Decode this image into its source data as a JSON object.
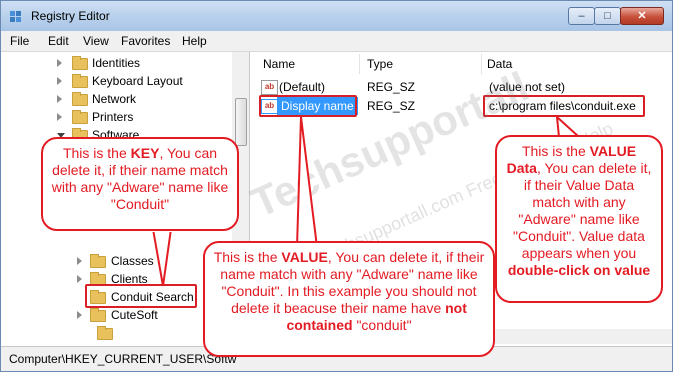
{
  "window": {
    "title": "Registry Editor",
    "controls": {
      "minimize": "–",
      "maximize": "□",
      "close": "✕"
    }
  },
  "menu": [
    "File",
    "Edit",
    "View",
    "Favorites",
    "Help"
  ],
  "tree": {
    "items": [
      {
        "label": "Identities"
      },
      {
        "label": "Keyboard Layout"
      },
      {
        "label": "Network"
      },
      {
        "label": "Printers"
      },
      {
        "label": "Software"
      },
      {
        "label": "Classes"
      },
      {
        "label": "Clients"
      },
      {
        "label": "Conduit Search",
        "highlighted": true
      },
      {
        "label": "CuteSoft"
      }
    ]
  },
  "values_pane": {
    "columns": [
      "Name",
      "Type",
      "Data"
    ],
    "rows": [
      {
        "icon": "ab",
        "name": "(Default)",
        "type": "REG_SZ",
        "data": "(value not set)"
      },
      {
        "icon": "ab",
        "name": "Display name",
        "type": "REG_SZ",
        "data": "c:\\program files\\conduit.exe",
        "selected": true
      }
    ]
  },
  "status": {
    "path": "Computer\\HKEY_CURRENT_USER\\Softw"
  },
  "watermark": {
    "main": "Techsupportall",
    "sub": "www.Techsupportall.com",
    "sub2": "Free Technical Help"
  },
  "callouts": {
    "key": {
      "pre": "This is the ",
      "strong": "KEY",
      "post": ", You can delete it, if their name match with any \"Adware\" name like \"Conduit\""
    },
    "value": {
      "pre": "This is the ",
      "strong": "VALUE",
      "mid": ", You can delete it, if their name match with any \"Adware\" name like \"Conduit\". In this example you should not delete it beacuse their name have ",
      "strong2": "not contained",
      "post": " \"conduit\""
    },
    "value_data": {
      "pre": "This is the ",
      "strong": "VALUE Data",
      "mid": ", You can delete it, if their Value Data match with any \"Adware\" name like \"Conduit\". Value data appears when you ",
      "strong2": "double-click on value"
    }
  },
  "colors": {
    "accent_red": "#e31b23",
    "selection_blue": "#3399ff",
    "folder": "#e8c15c"
  }
}
